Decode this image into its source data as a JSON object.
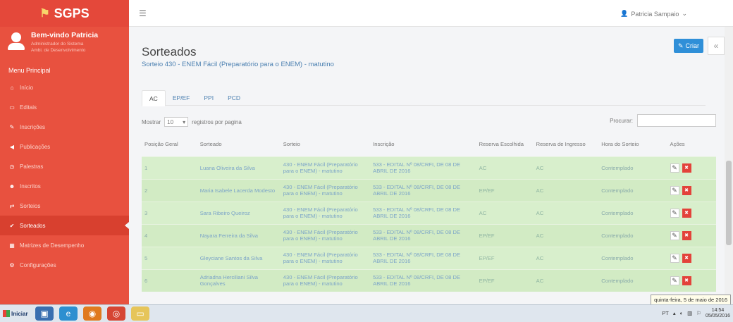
{
  "app": {
    "name": "SGPS"
  },
  "sidebar": {
    "welcome_title": "Bem-vindo Patricia",
    "welcome_role": "Administrador do Sistema",
    "welcome_org": "Ambi. de Desenvolvimento",
    "menu_title": "Menu Principal",
    "items": [
      {
        "label": "Início",
        "icon": "home-icon"
      },
      {
        "label": "Editais",
        "icon": "file-icon"
      },
      {
        "label": "Inscrições",
        "icon": "pencil-icon"
      },
      {
        "label": "Publicações",
        "icon": "megaphone-icon"
      },
      {
        "label": "Palestras",
        "icon": "clock-icon"
      },
      {
        "label": "Inscritos",
        "icon": "users-icon"
      },
      {
        "label": "Sorteios",
        "icon": "shuffle-icon"
      },
      {
        "label": "Sorteados",
        "icon": "check-circle-icon"
      },
      {
        "label": "Matrizes de Desempenho",
        "icon": "table-icon"
      },
      {
        "label": "Configurações",
        "icon": "gears-icon"
      }
    ],
    "active_index": 7
  },
  "topbar": {
    "user_name": "Patricia Sampaio"
  },
  "page": {
    "title": "Sorteados",
    "subtitle": "Sorteio 430 - ENEM Fácil (Preparatório para o ENEM) - matutino",
    "create_label": "Criar",
    "collapse_label": "«"
  },
  "tabs": [
    "AC",
    "EP/EF",
    "PPI",
    "PCD"
  ],
  "controls": {
    "show_label": "Mostrar",
    "page_size": "10",
    "per_page_label": "registros por pagina",
    "search_label": "Procurar:"
  },
  "table": {
    "headers": [
      "Posição Geral",
      "Sorteado",
      "Sorteio",
      "Inscrição",
      "Reserva Escolhida",
      "Reserva de Ingresso",
      "Hora do Sorteio",
      "Ações"
    ],
    "rows": [
      {
        "pos": "1",
        "name": "Luana Oliveira da Silva",
        "sorteio": "430 - ENEM Fácil (Preparatório para o ENEM) - matutino",
        "inscricao": "533 - EDITAL Nº 08/CRFI, DE 08 DE ABRIL DE 2016",
        "res_esc": "AC",
        "res_ing": "AC",
        "hora": "Contemplado"
      },
      {
        "pos": "2",
        "name": "Maria Isabele Lacerda Modesto",
        "sorteio": "430 - ENEM Fácil (Preparatório para o ENEM) - matutino",
        "inscricao": "533 - EDITAL Nº 08/CRFI, DE 08 DE ABRIL DE 2016",
        "res_esc": "EP/EF",
        "res_ing": "AC",
        "hora": "Contemplado"
      },
      {
        "pos": "3",
        "name": "Sara Ribeiro Queiroz",
        "sorteio": "430 - ENEM Fácil (Preparatório para o ENEM) - matutino",
        "inscricao": "533 - EDITAL Nº 08/CRFI, DE 08 DE ABRIL DE 2016",
        "res_esc": "AC",
        "res_ing": "AC",
        "hora": "Contemplado"
      },
      {
        "pos": "4",
        "name": "Nayara Ferreira da Silva",
        "sorteio": "430 - ENEM Fácil (Preparatório para o ENEM) - matutino",
        "inscricao": "533 - EDITAL Nº 08/CRFI, DE 08 DE ABRIL DE 2016",
        "res_esc": "EP/EF",
        "res_ing": "AC",
        "hora": "Contemplado"
      },
      {
        "pos": "5",
        "name": "Gleyciane Santos da Silva",
        "sorteio": "430 - ENEM Fácil (Preparatório para o ENEM) - matutino",
        "inscricao": "533 - EDITAL Nº 08/CRFI, DE 08 DE ABRIL DE 2016",
        "res_esc": "EP/EF",
        "res_ing": "AC",
        "hora": "Contemplado"
      },
      {
        "pos": "6",
        "name": "Adriadna Herciliani Silva Gonçalves",
        "sorteio": "430 - ENEM Fácil (Preparatório para o ENEM) - matutino",
        "inscricao": "533 - EDITAL Nº 08/CRFI, DE 08 DE ABRIL DE 2016",
        "res_esc": "EP/EF",
        "res_ing": "AC",
        "hora": "Contemplado"
      }
    ]
  },
  "taskbar": {
    "start_label": "Iniciar",
    "lang": "PT",
    "time": "14:54",
    "date": "05/05/2016",
    "tooltip": "quinta-feira, 5 de maio de 2016"
  },
  "colors": {
    "sidebar": "#e8513f",
    "accent": "#2f8fd8",
    "row": "#d8efcc",
    "delete": "#e3423a"
  }
}
